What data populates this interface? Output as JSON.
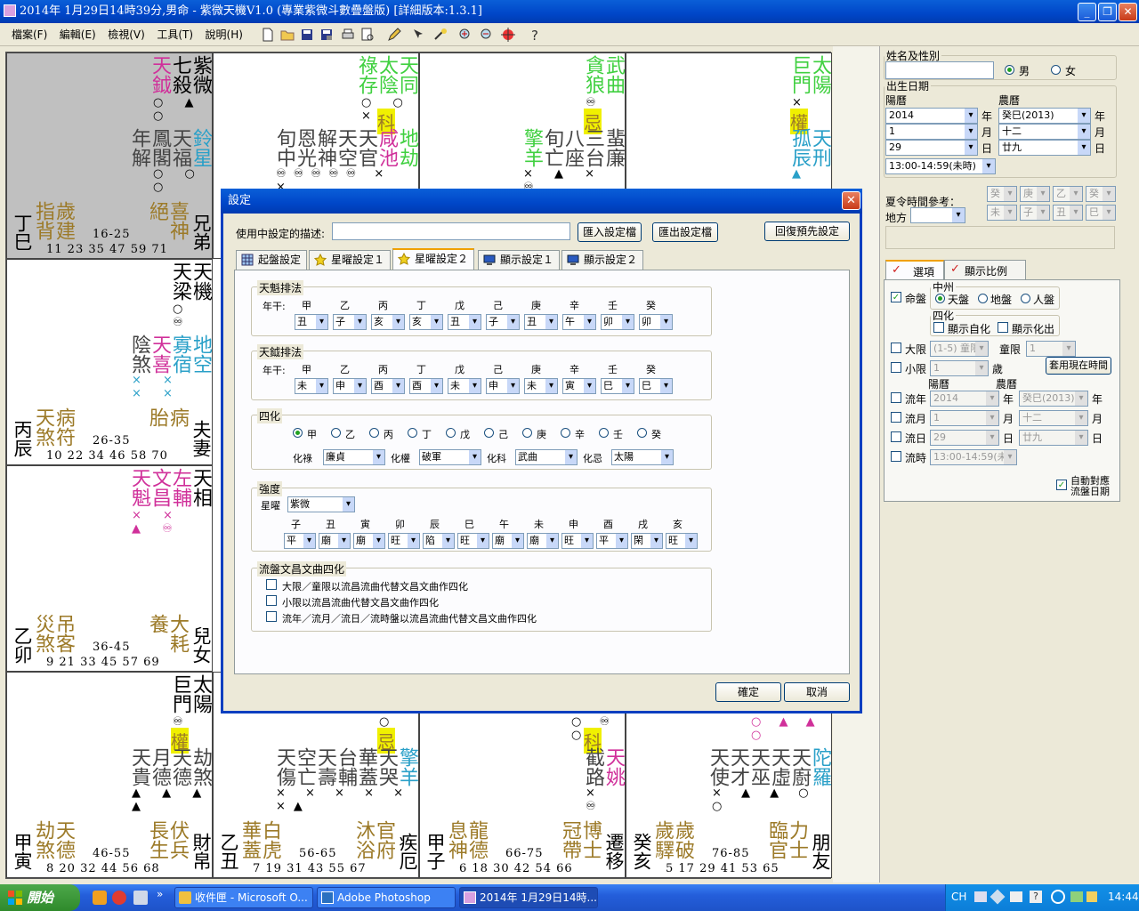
{
  "window": {
    "title": "2014年 1月29日14時39分,男命 - 紫微天機V1.0 (專業紫微斗數疊盤版) [詳細版本:1.3.1]",
    "btn_min": "_",
    "btn_max": "❐",
    "btn_close": "✕"
  },
  "menu": [
    "檔案(F)",
    "編輯(E)",
    "檢視(V)",
    "工具(T)",
    "說明(H)"
  ],
  "toolbar": [
    "new-file",
    "open-folder",
    "save",
    "save-as",
    "print",
    "print-preview",
    "pencil",
    "cursor-pen",
    "magic",
    "zoom-in",
    "zoom-out",
    "crosshair",
    "help"
  ],
  "chart": {
    "c1": {
      "s1": "紫微",
      "s2": "七殺",
      "s3": "天鉞",
      "mk": "○ ▲ ○",
      "m1": "鈴星",
      "m2": "天福",
      "m3": "鳳閣",
      "m4": "年解",
      "mk2": "○ ○ ○",
      "a1": "歲建",
      "a2": "指背",
      "g1": "喜神",
      "g2": "絕",
      "ages1": "16-25",
      "ages2": "11 23 35 47 59 71",
      "gz": "丁巳",
      "pal": "兄弟"
    },
    "c2": {
      "s1": "天同",
      "s2": "太陰",
      "s3": "祿存",
      "hua": "科",
      "mk": "○ ○ ×",
      "m": [
        "地劫",
        "咸池",
        "天官",
        "天空",
        "解神",
        "恩光",
        "旬中"
      ],
      "mk2": "♾♾♾♾♾ × ×"
    },
    "c3": {
      "s1": "武曲",
      "s2": "貪狼",
      "hua": "忌",
      "mk": "♾ ♾",
      "m": [
        "蜚廉",
        "三台",
        "八座",
        "旬亡",
        "擎羊"
      ],
      "mk2": "× ▲ × ♾"
    },
    "c4": {
      "s1": "太陽",
      "s2": "巨門",
      "hua": "權",
      "mk": "× ○",
      "m": [
        "天刑",
        "孤辰"
      ],
      "mk2": "▲"
    },
    "c5": {
      "s1": "天機",
      "s2": "天梁",
      "mk": "○ ♾",
      "m1": "地空",
      "m2": "寡宿",
      "m3": "天喜",
      "m4": "陰煞",
      "mk2": "× × × ×",
      "a1": "病符",
      "a2": "天煞",
      "g1": "病",
      "g2": "胎",
      "ages1": "26-35",
      "ages2": "10 22 34 46 58 70",
      "gz": "丙辰",
      "pal": "夫妻"
    },
    "c6": {
      "s1": "天相",
      "s2": "左輔",
      "s3": "文昌",
      "s4": "天魁",
      "mk": "× × ▲ ♾"
    },
    "c7": {
      "a1": "吊客",
      "a2": "災煞",
      "g1": "大耗",
      "g2": "養",
      "ages1": "36-45",
      "ages2": "9 21 33 45 57 69",
      "gz": "乙卯",
      "pal": "兒女"
    },
    "c8": {
      "s1": "太陽",
      "s2": "巨門",
      "hua": "權",
      "mk": "♾ ○",
      "m": [
        "劫煞",
        "天德",
        "月德",
        "天貴"
      ],
      "mk2": "▲ ▲ ▲ ▲",
      "a1": "天德",
      "a2": "劫煞",
      "g1": "伏兵",
      "g2": "長生",
      "ages1": "46-55",
      "ages2": "8 20 32 44 56 68",
      "gz": "甲寅",
      "pal": "財帛"
    },
    "c9": {
      "hua": "忌",
      "mk": "○ ♾",
      "m": [
        "擎羊",
        "天哭",
        "華蓋",
        "台輔",
        "天壽",
        "空亡",
        "天傷"
      ],
      "mk2": "× × × × × ×▲",
      "a1": "白虎",
      "a2": "華蓋",
      "g1": "官府",
      "g2": "沐浴",
      "ages1": "56-65",
      "ages2": "7 19 31 43 55 67",
      "gz": "乙丑",
      "pal": "疾厄"
    },
    "c10": {
      "hua": "科",
      "mk": "○ ♾ ○",
      "m": [
        "天姚",
        "截路"
      ],
      "mk2": "× ♾",
      "a1": "龍德",
      "a2": "息神",
      "g1": "博士",
      "g2": "冠帶",
      "ages1": "66-75",
      "ages2": "6 18 30 42 54 66",
      "gz": "甲子",
      "pal": "遷移"
    },
    "c11": {
      "mk": "○ ▲ ▲ ○",
      "m": [
        "陀羅",
        "天廚",
        "天虛",
        "天巫",
        "天才",
        "天使"
      ],
      "mk2": "× ▲ ▲ ○ ○",
      "a1": "歲破",
      "a2": "歲驛",
      "g1": "力士",
      "g2": "臨官",
      "ages1": "76-85",
      "ages2": "5 17 29 41 53 65",
      "gz": "癸亥",
      "pal": "朋友"
    }
  },
  "right": {
    "name_legend": "姓名及性別",
    "male": "男",
    "female": "女",
    "birth_legend": "出生日期",
    "solar": "陽曆",
    "lunar": "農曆",
    "year": "2014",
    "year_u": "年",
    "lyear": "癸巳(2013)",
    "month": "1",
    "month_u": "月",
    "lmonth": "十二",
    "day": "29",
    "day_u": "日",
    "lday": "廿九",
    "hour": "13:00-14:59(未時)",
    "dst": "夏令時間參考：",
    "place": "地方",
    "gz": [
      "癸",
      "庚",
      "乙",
      "癸",
      "未",
      "子",
      "丑",
      "巳"
    ],
    "tab_opts": "選項",
    "tab_scale": "顯示比例",
    "mingpan": "命盤",
    "zhongzhou": "中州",
    "tianpan": "天盤",
    "dipan": "地盤",
    "renpan": "人盤",
    "sihua": "四化",
    "zihua": "顯示自化",
    "huachu": "顯示化出",
    "daxian": "大限",
    "daxian_v": "(1-5) 童限",
    "tongxian": "童限",
    "tongxian_v": "1",
    "xiaoxian": "小限",
    "xiaoxian_v": "1",
    "sui": "歲",
    "use_now": "套用現在時間",
    "solar2": "陽曆",
    "lunar2": "農曆",
    "liunian": "流年",
    "ln_v": "2014",
    "ln_l": "癸巳(2013)",
    "liuyue": "流月",
    "ly_v": "1",
    "ly_l": "十二",
    "liuri": "流日",
    "lr_v": "29",
    "lr_l": "廿九",
    "liushi": "流時",
    "ls_v": "13:00-14:59(未時)",
    "auto": "自動對應",
    "auto2": "流盤日期"
  },
  "dialog": {
    "title": "設定",
    "close": "✕",
    "desc_label": "使用中設定的描述:",
    "desc_value": "",
    "import": "匯入設定檔",
    "export": "匯出設定檔",
    "reset": "回復預先設定",
    "tabs": [
      "起盤設定",
      "星曜設定１",
      "星曜設定２",
      "顯示設定１",
      "顯示設定２"
    ],
    "kui_title": "天魁排法",
    "yue_title": "天鉞排法",
    "nian_gan": "年干:",
    "stems": [
      "甲",
      "乙",
      "丙",
      "丁",
      "戊",
      "己",
      "庚",
      "辛",
      "壬",
      "癸"
    ],
    "kui_vals": [
      "丑",
      "子",
      "亥",
      "亥",
      "丑",
      "子",
      "丑",
      "午",
      "卯",
      "卯"
    ],
    "yue_vals": [
      "未",
      "申",
      "酉",
      "酉",
      "未",
      "申",
      "未",
      "寅",
      "巳",
      "巳"
    ],
    "sihua_title": "四化",
    "lu": "化祿",
    "lu_v": "廉貞",
    "quan": "化權",
    "quan_v": "破軍",
    "ke": "化科",
    "ke_v": "武曲",
    "ji": "化忌",
    "ji_v": "太陽",
    "str_title": "強度",
    "star": "星曜",
    "star_v": "紫微",
    "branches": [
      "子",
      "丑",
      "寅",
      "卯",
      "辰",
      "巳",
      "午",
      "未",
      "申",
      "酉",
      "戌",
      "亥"
    ],
    "str_vals": [
      "平",
      "廟",
      "廟",
      "旺",
      "陷",
      "旺",
      "廟",
      "廟",
      "旺",
      "平",
      "閑",
      "旺"
    ],
    "wc_title": "流盤文昌文曲四化",
    "wc1": "大限／童限以流昌流曲代替文昌文曲作四化",
    "wc2": "小限以流昌流曲代替文昌文曲作四化",
    "wc3": "流年／流月／流日／流時盤以流昌流曲代替文昌文曲作四化",
    "ok": "確定",
    "cancel": "取消"
  },
  "taskbar": {
    "start": "開始",
    "t1": "收件匣 - Microsoft O...",
    "t2": "Adobe Photoshop",
    "t3": "2014年 1月29日14時...",
    "lang": "CH",
    "clock": "14:44"
  }
}
